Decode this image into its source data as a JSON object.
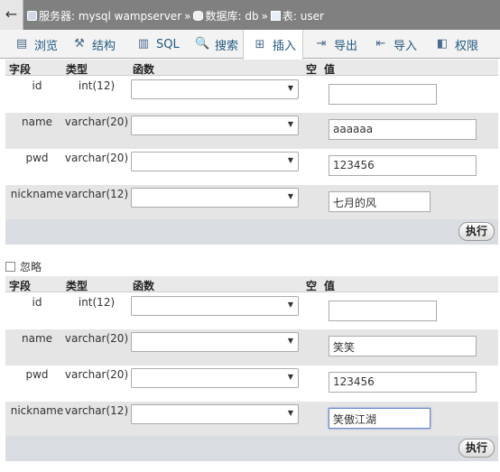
{
  "breadcrumb": {
    "back": "←",
    "server": "服务器: mysql wampserver",
    "database": "数据库: db",
    "table": "表: user",
    "separator": "»"
  },
  "tabs": [
    {
      "label": "浏览",
      "icon": "browse-icon",
      "glyph": "▤"
    },
    {
      "label": "结构",
      "icon": "structure-icon",
      "glyph": "⚒"
    },
    {
      "label": "SQL",
      "icon": "sql-icon",
      "glyph": "▥"
    },
    {
      "label": "搜索",
      "icon": "search-icon",
      "glyph": "🔍"
    },
    {
      "label": "插入",
      "icon": "insert-icon",
      "glyph": "⊞",
      "active": true
    },
    {
      "label": "导出",
      "icon": "export-icon",
      "glyph": "⇥"
    },
    {
      "label": "导入",
      "icon": "import-icon",
      "glyph": "⇤"
    },
    {
      "label": "权限",
      "icon": "privileges-icon",
      "glyph": "◧"
    }
  ],
  "columns": {
    "field": "字段",
    "type": "类型",
    "function": "函数",
    "null": "空",
    "value": "值"
  },
  "form1": {
    "rows": [
      {
        "name": "id",
        "type": "int(12)",
        "value": ""
      },
      {
        "name": "name",
        "type": "varchar(20)",
        "value": "aaaaaa"
      },
      {
        "name": "pwd",
        "type": "varchar(20)",
        "value": "123456"
      },
      {
        "name": "nickname",
        "type": "varchar(12)",
        "value": "七月的风"
      }
    ],
    "submit": "执行"
  },
  "ignore_label": "忽略",
  "form2": {
    "rows": [
      {
        "name": "id",
        "type": "int(12)",
        "value": ""
      },
      {
        "name": "name",
        "type": "varchar(20)",
        "value": "笑笑"
      },
      {
        "name": "pwd",
        "type": "varchar(20)",
        "value": "123456"
      },
      {
        "name": "nickname",
        "type": "varchar(12)",
        "value": "笑傲江湖"
      }
    ],
    "submit": "执行"
  }
}
